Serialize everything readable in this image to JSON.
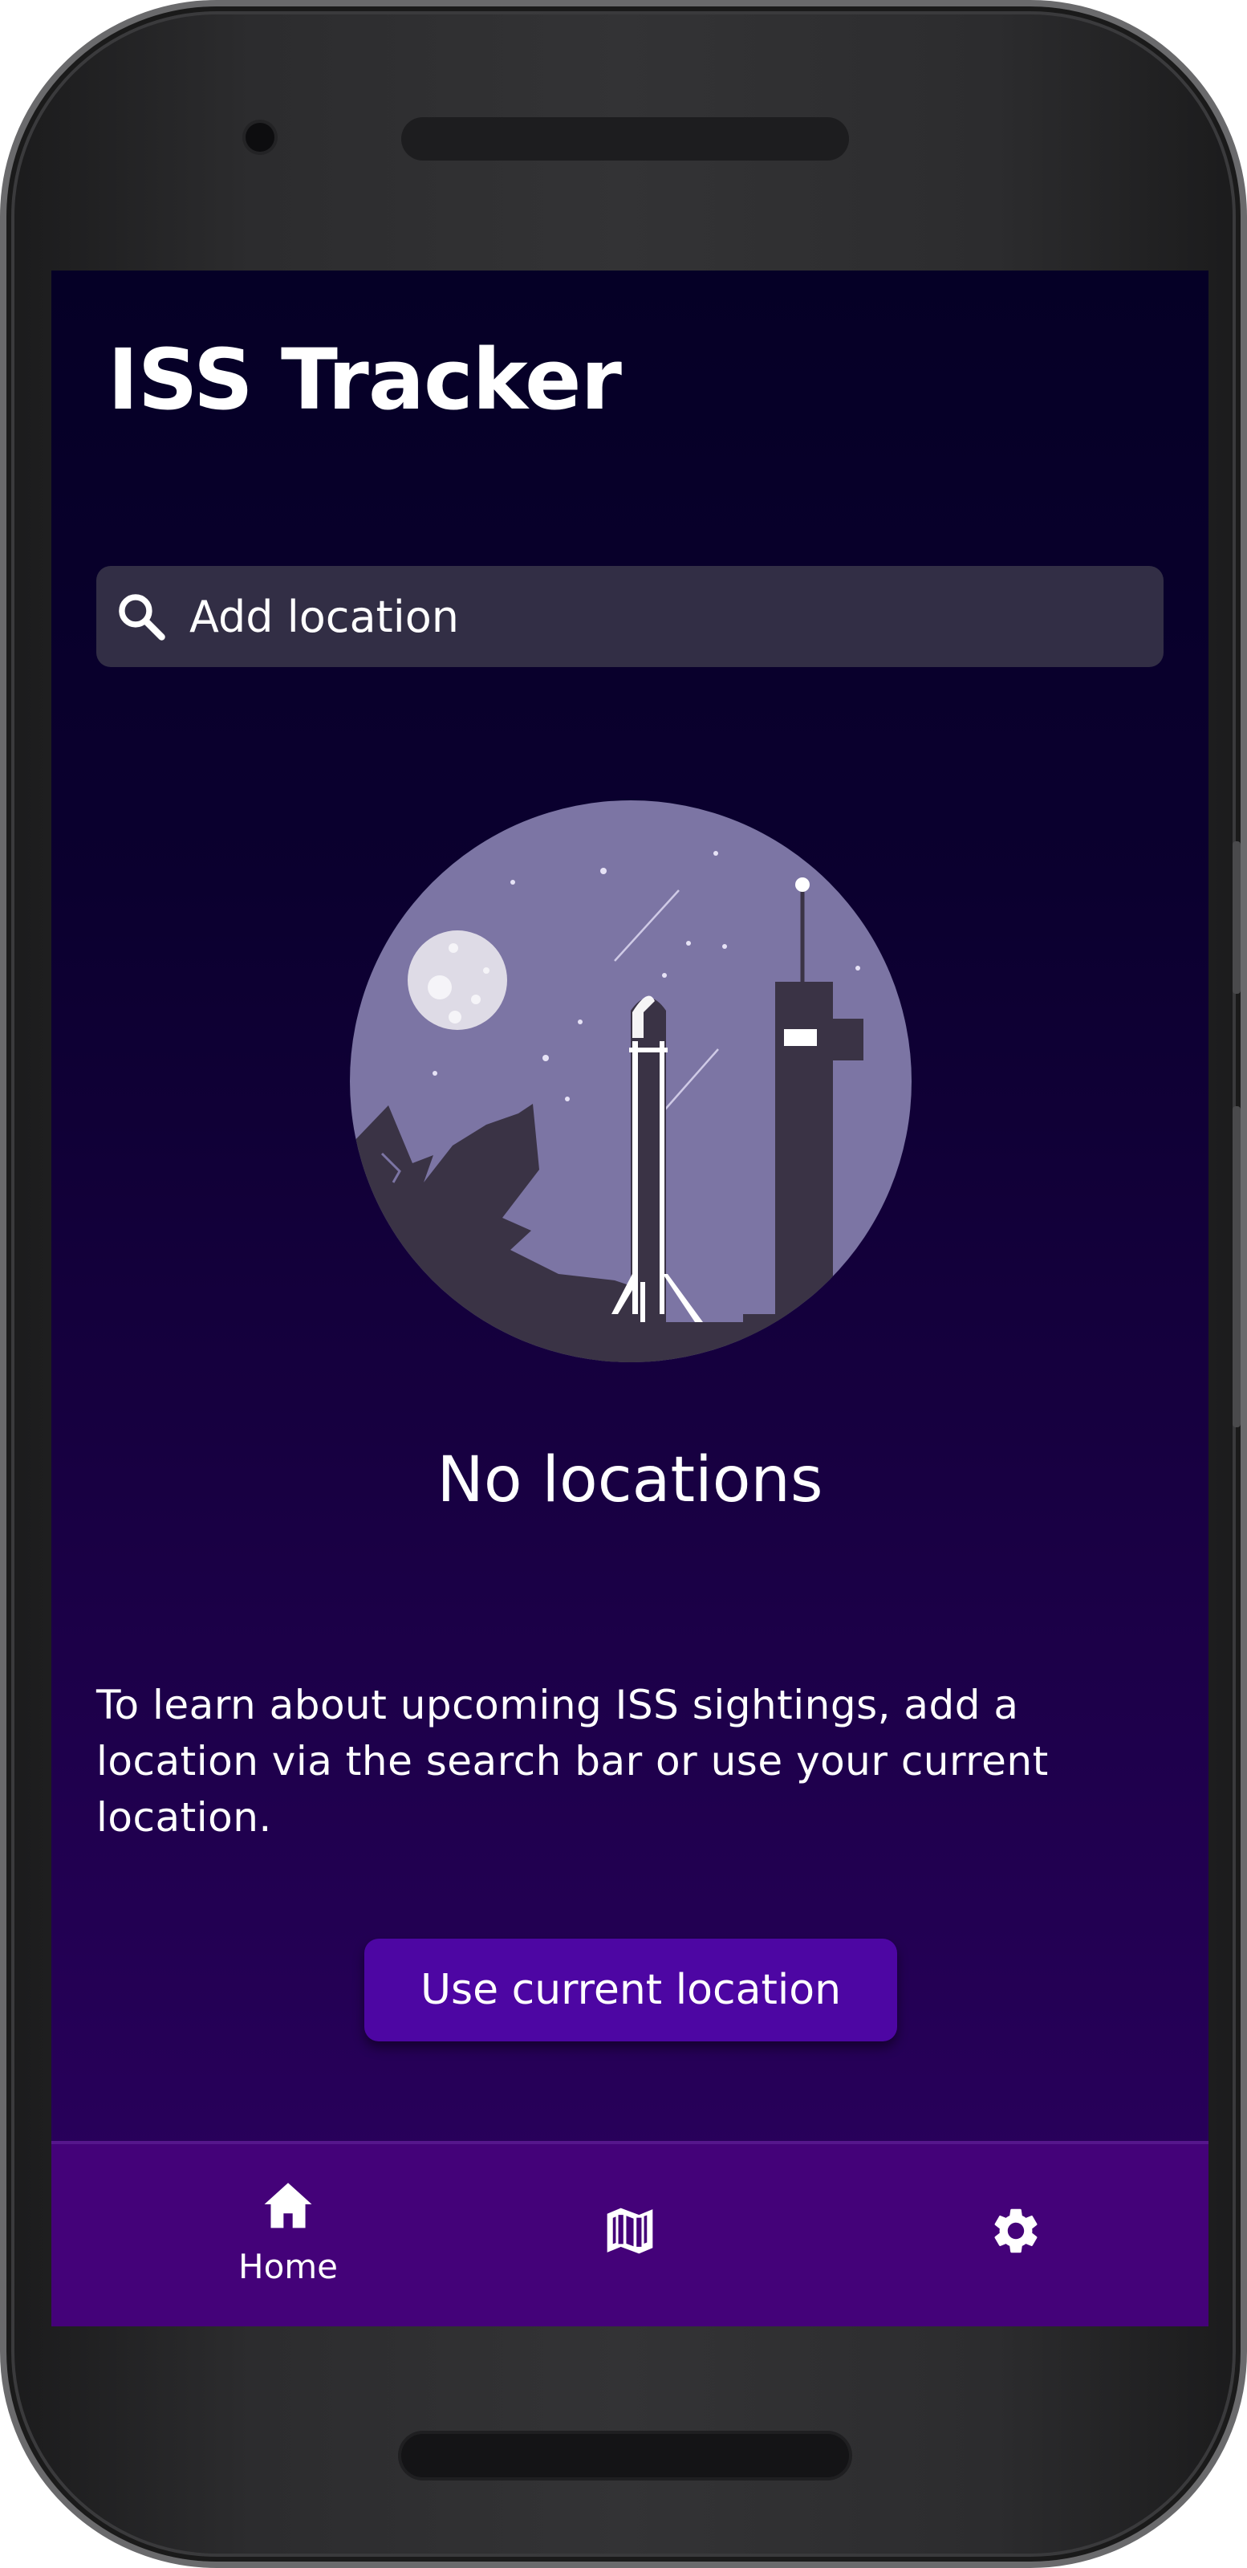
{
  "app": {
    "title": "ISS Tracker"
  },
  "search": {
    "placeholder": "Add location",
    "value": ""
  },
  "empty_state": {
    "title": "No locations",
    "description": "To learn about upcoming ISS sightings, add a location via the search bar or use your current location.",
    "illustration": "rocket-launch-night-scene"
  },
  "actions": {
    "use_current_location": "Use current location"
  },
  "nav": {
    "items": [
      {
        "id": "home",
        "icon": "home-icon",
        "label": "Home",
        "selected": true
      },
      {
        "id": "map",
        "icon": "map-icon",
        "label": "",
        "selected": false
      },
      {
        "id": "settings",
        "icon": "gear-icon",
        "label": "",
        "selected": false
      }
    ]
  },
  "colors": {
    "background_top": "#050026",
    "background_bottom": "#2c0060",
    "search_bar": "#322e45",
    "button": "#4d06a3",
    "nav_bar": "#440279",
    "illustration_sky": "#7c75a4"
  }
}
